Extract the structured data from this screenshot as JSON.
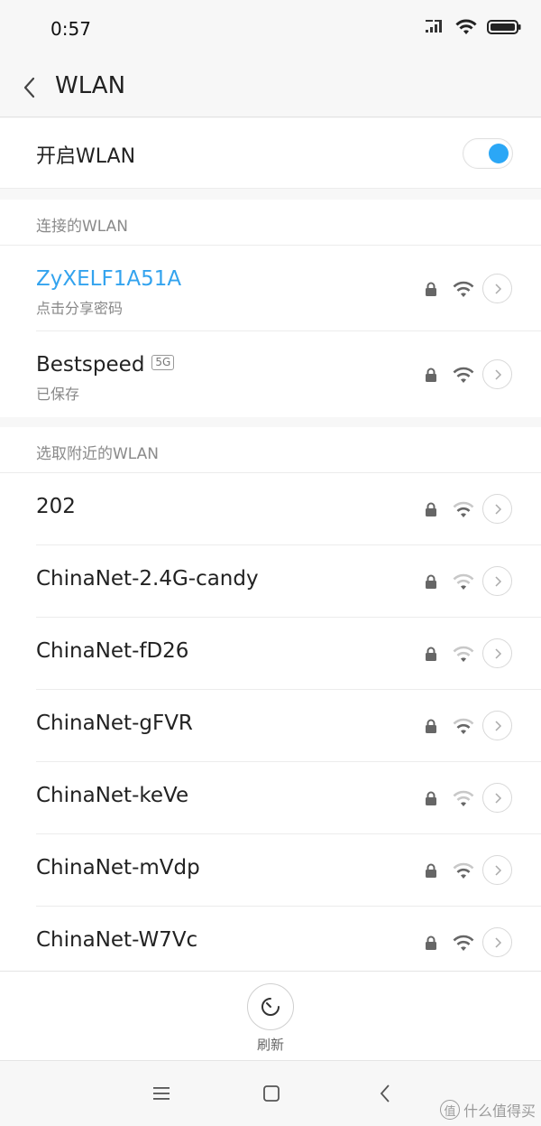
{
  "status_bar": {
    "time": "0:57"
  },
  "header": {
    "title": "WLAN"
  },
  "wlan_toggle": {
    "label": "开启WLAN",
    "state": "on",
    "accent": "#2ba7f6"
  },
  "connected": {
    "header": "连接的WLAN",
    "networks": [
      {
        "name": "ZyXELF1A51A",
        "sub": "点击分享密码",
        "locked": true,
        "signal": 4
      },
      {
        "name": "Bestspeed",
        "badge": "5G",
        "sub": "已保存",
        "locked": true,
        "signal": 4
      }
    ]
  },
  "nearby": {
    "header": "选取附近的WLAN",
    "networks": [
      {
        "name": "202",
        "locked": true,
        "signal": 3
      },
      {
        "name": "ChinaNet-2.4G-candy",
        "locked": true,
        "signal": 2
      },
      {
        "name": "ChinaNet-fD26",
        "locked": true,
        "signal": 2
      },
      {
        "name": "ChinaNet-gFVR",
        "locked": true,
        "signal": 3
      },
      {
        "name": "ChinaNet-keVe",
        "locked": true,
        "signal": 2
      },
      {
        "name": "ChinaNet-mVdp",
        "locked": true,
        "signal": 3
      },
      {
        "name": "ChinaNet-W7Vc",
        "locked": true,
        "signal": 4
      }
    ]
  },
  "bottom": {
    "refresh_label": "刷新"
  },
  "watermark": {
    "text": "什么值得买",
    "icon": "值"
  },
  "colors": {
    "connected_text": "#33a3ee",
    "accent": "#2ba7f6"
  }
}
